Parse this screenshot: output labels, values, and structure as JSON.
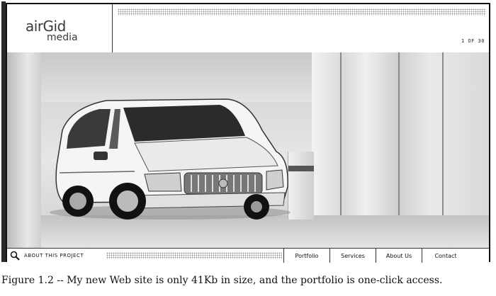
{
  "header": {
    "logo_top": "airGid",
    "logo_bottom": "media",
    "counter": "1 OF 30"
  },
  "hero": {
    "image_alt": "Minivan parked beside a building"
  },
  "bottom": {
    "about_label": "ABOUT THIS PROJECT",
    "nav": [
      {
        "label": "Portfolio"
      },
      {
        "label": "Services"
      },
      {
        "label": "About Us"
      },
      {
        "label": "Contact"
      }
    ]
  },
  "caption": "Figure 1.2 -- My new Web site is only 41Kb in size, and the portfolio is one-click access."
}
